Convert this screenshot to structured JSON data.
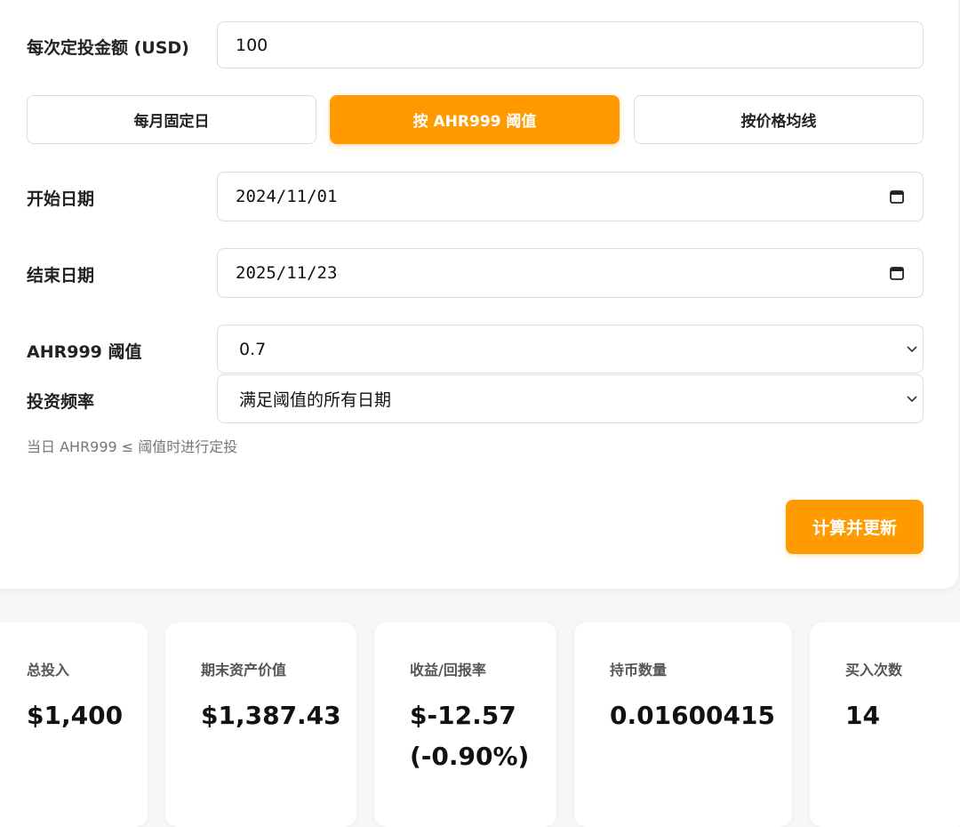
{
  "form": {
    "amount_label": "每次定投金额 (USD)",
    "amount_value": "100",
    "modes": [
      {
        "label": "每月固定日",
        "active": false
      },
      {
        "label": "按 AHR999 阈值",
        "active": true
      },
      {
        "label": "按价格均线",
        "active": false
      }
    ],
    "start_label": "开始日期",
    "start_value": "2024/11/01",
    "end_label": "结束日期",
    "end_value": "2025/11/23",
    "threshold_label": "AHR999 阈值",
    "threshold_value": "0.7",
    "frequency_label": "投资频率",
    "frequency_value": "满足阈值的所有日期",
    "hint": "当日 AHR999 ≤ 阈值时进行定投",
    "calc_button": "计算并更新"
  },
  "stats": [
    {
      "label": "总投入",
      "value": "$1,400"
    },
    {
      "label": "期末资产价值",
      "value": "$1,387.43"
    },
    {
      "label": "收益/回报率",
      "value": "$-12.57",
      "value2": "(-0.90%)"
    },
    {
      "label": "持币数量",
      "value": "0.01600415"
    },
    {
      "label": "买入次数",
      "value": "14"
    }
  ],
  "colors": {
    "accent": "#ff9a00"
  }
}
